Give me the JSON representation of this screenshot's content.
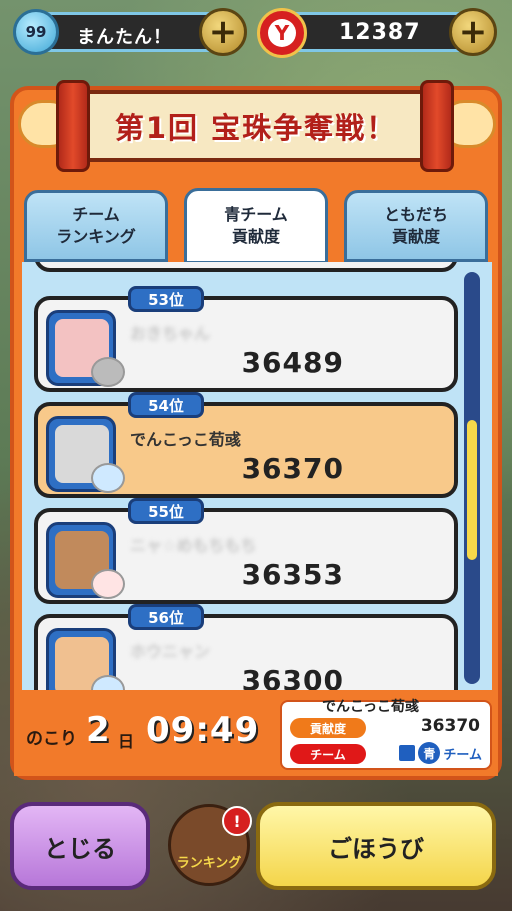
{
  "hud": {
    "stamina_value": "99",
    "stamina_label": "まんたん！",
    "money": "12387",
    "coin_symbol": "Y",
    "plus": "+"
  },
  "banner": {
    "title": "第1回 宝珠争奪戦！"
  },
  "tabs": [
    {
      "label_line1": "チーム",
      "label_line2": "ランキング"
    },
    {
      "label_line1": "青チーム",
      "label_line2": "貢献度"
    },
    {
      "label_line1": "ともだち",
      "label_line2": "貢献度"
    }
  ],
  "rows": [
    {
      "rank": "53位",
      "name": "おきちゃん",
      "score": "36489"
    },
    {
      "rank": "54位",
      "name": "でんこっこ荀彧",
      "score": "36370"
    },
    {
      "rank": "55位",
      "name": "ニャ☆めもちもち",
      "score": "36353"
    },
    {
      "rank": "56位",
      "name": "ホウニャン",
      "score": "36300"
    }
  ],
  "footer": {
    "remain_label": "のこり",
    "days": "2",
    "days_unit": "日",
    "timer": "09:49",
    "me_name": "でんこっこ荀彧",
    "contrib_tag": "貢献度",
    "team_tag": "チーム",
    "me_score": "36370",
    "team_char": "青",
    "team_word": "チーム"
  },
  "buttons": {
    "close": "とじる",
    "ranking": "ランキング",
    "reward": "ごほうび",
    "alert": "!"
  },
  "colors": {
    "panel_orange": "#f27a2a",
    "tab_blue": "#bfe3f6",
    "highlight_row": "#f8c98a",
    "rank_blue": "#2e6fc4"
  }
}
